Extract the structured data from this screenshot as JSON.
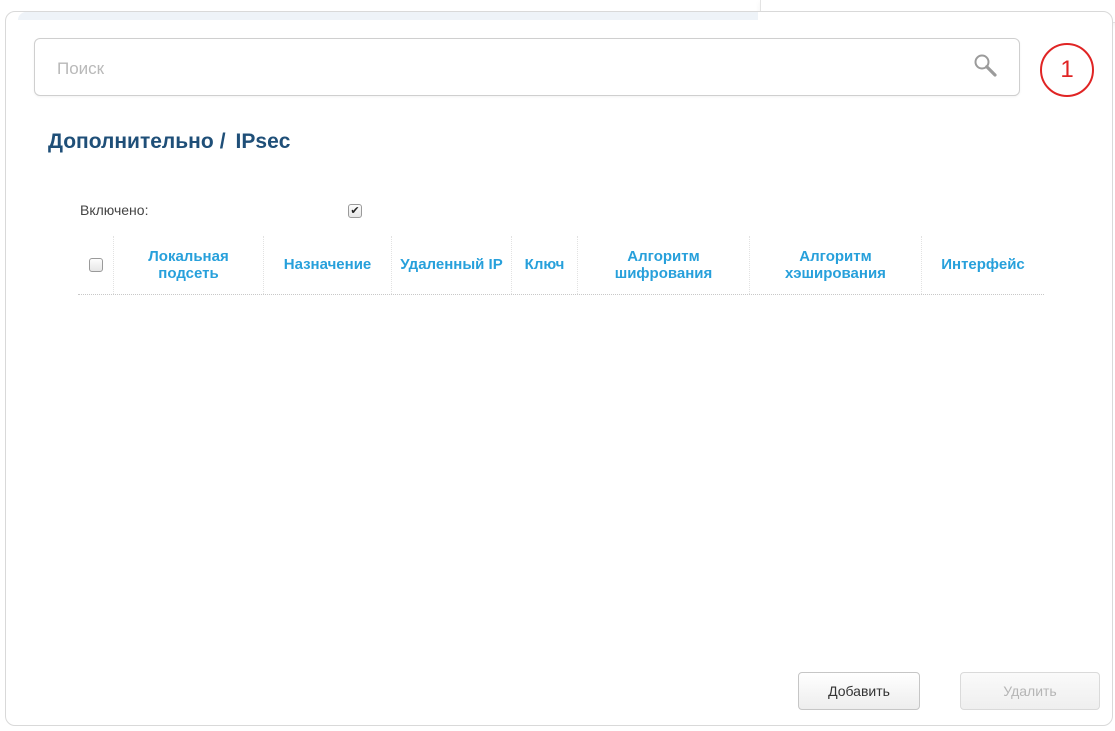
{
  "search": {
    "placeholder": "Поиск",
    "value": ""
  },
  "notification": {
    "count": "1"
  },
  "breadcrumb": {
    "parent": "Дополнительно",
    "separator": "/",
    "current": "IPsec"
  },
  "settings": {
    "enabled_label": "Включено:",
    "enabled_checked": true
  },
  "table": {
    "columns": [
      "Локальная подсеть",
      "Назначение",
      "Удаленный IP",
      "Ключ",
      "Алгоритм шифрования",
      "Алгоритм хэширования",
      "Интерфейс"
    ],
    "rows": []
  },
  "actions": {
    "add_label": "Добавить",
    "delete_label": "Удалить"
  },
  "colors": {
    "title": "#1f4f78",
    "column_header": "#27a0db",
    "badge": "#e02424"
  },
  "icons": {
    "search": "search-icon",
    "enabled_check": "checkmark-icon"
  }
}
